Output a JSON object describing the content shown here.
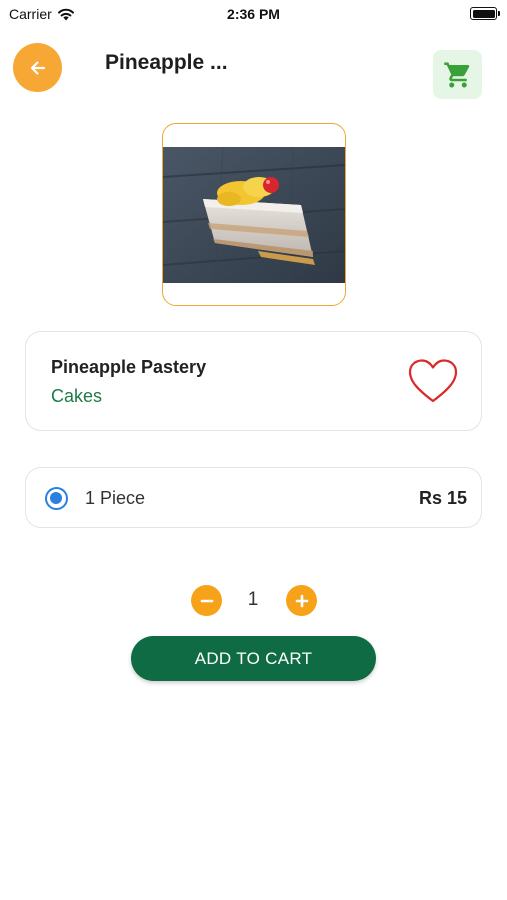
{
  "status_bar": {
    "carrier": "Carrier",
    "time": "2:36 PM"
  },
  "header": {
    "title": "Pineapple ...",
    "back_icon": "arrow-left-icon",
    "cart_icon": "shopping-cart-icon"
  },
  "product": {
    "name": "Pineapple Pastery",
    "category": "Cakes",
    "image": "pineapple-pastry-photo",
    "favorite_icon": "heart-outline-icon"
  },
  "option": {
    "label": "1 Piece",
    "price": "Rs 15",
    "selected": true
  },
  "quantity": {
    "value": "1"
  },
  "actions": {
    "add_to_cart_label": "ADD TO CART"
  },
  "colors": {
    "accent_orange": "#f7a733",
    "brand_green": "#0e6b43",
    "category_green": "#1e7a47",
    "cart_bg": "#e6f6e6",
    "cart_icon": "#3aa03a",
    "heart_red": "#d92b2b",
    "radio_blue": "#2b7fe0"
  }
}
